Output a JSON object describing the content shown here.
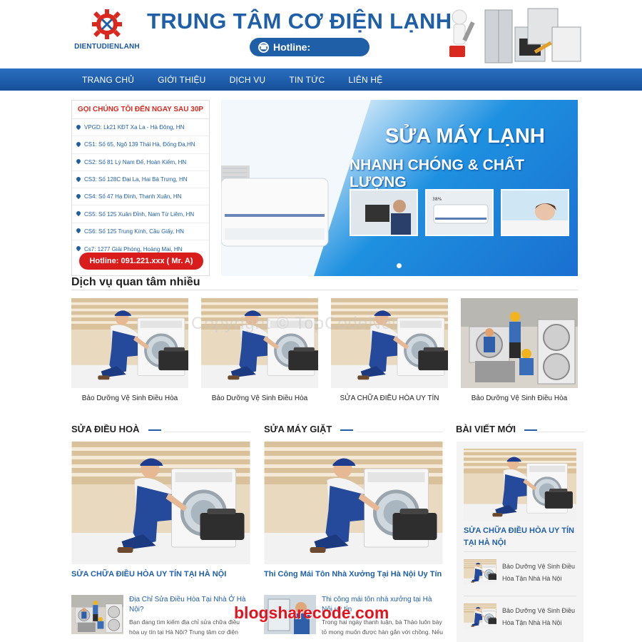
{
  "header": {
    "logo_text": "DIENTUDIENLANH",
    "site_title": "TRUNG TÂM CƠ ĐIỆN LẠNH",
    "hotline_label": "Hotline:"
  },
  "nav": {
    "items": [
      "TRANG CHỦ",
      "GIỚI THIỆU",
      "DỊCH VỤ",
      "TIN TỨC",
      "LIÊN HỆ"
    ]
  },
  "contact": {
    "title": "GỌI CHÚNG TÔI ĐẾN NGAY SAU 30P",
    "rows": [
      "VPGD: Lk21 KĐT Xa La - Hà Đông, HN",
      "CS1: Số 65, Ngõ 139 Thái Hà, Đống Đa,HN",
      "CS2: Số 81 Lý Nam Đế, Hoàn Kiếm, HN",
      "CS3: Số 128C Đại La, Hai Bà Trưng, HN",
      "CS4: Số 47 Hạ Đình, Thanh Xuân, HN",
      "CS5: Số 125 Xuân Đỉnh, Nam Từ Liêm, HN",
      "CS6: Số 125 Trung Kính, Cầu Giấy, HN",
      "Cs7: 1277 Giải Phóng, Hoàng Mai, HN"
    ],
    "hotline": "Hotline: 091.221.xxx ( Mr. A)"
  },
  "banner": {
    "line1": "SỬA MÁY LẠNH",
    "line2": "NHANH CHÓNG & CHẤT LƯỢNG",
    "thumb_label": "38%"
  },
  "services": {
    "title": "Dịch vụ quan tâm nhiều",
    "watermark": "Copyright © TopCodeNet",
    "cards": [
      "Bảo Dưỡng Vệ Sinh Điều Hòa",
      "Bảo Dưỡng Vệ Sinh Điều Hòa",
      "SỬA CHỮA ĐIỀU HÒA UY TÍN",
      "Bảo Dưỡng Vệ Sinh Điều Hòa"
    ]
  },
  "col1": {
    "title": "SỬA ĐIỀU HOÀ",
    "feature_caption": "SỬA CHỮA ĐIỀU HÒA UY TÍN TẠI HÀ NỘI",
    "news_title": "Địa Chỉ Sửa Điều Hòa Tại Nhà Ở Hà Nội?",
    "news_desc": "Bạn đang tìm kiếm địa chỉ sửa chữa điều hòa uy tín tại Hà Nội? Trung tâm cơ điện"
  },
  "col2": {
    "title": "SỬA MÁY GIẶT",
    "feature_caption": "Thi Công Mái Tôn Nhà Xưởng Tại Hà Nội Uy Tín",
    "news_title": "Thi công mái tôn nhà xưởng tại Hà Nội uy tín",
    "news_desc": "Trong hai ngày thanh luận, bà Thảo luôn bày tỏ mong muốn được hàn gắn với chồng. Nếu"
  },
  "sidebar": {
    "title": "BÀI VIẾT MỚI",
    "feature_caption": "SỬA CHỮA ĐIỀU HÒA UY TÍN TẠI HÀ NỘI",
    "items": [
      "Bảo Dưỡng Vệ Sinh Điều Hòa Tận Nhà Hà Nội",
      "Bảo Dưỡng Vệ Sinh Điều Hòa Tận Nhà Hà Nội"
    ]
  },
  "overlay": {
    "brand": "blogsharecode.com"
  },
  "colors": {
    "primary": "#1f5fa8",
    "accent_red": "#d91d1d"
  }
}
